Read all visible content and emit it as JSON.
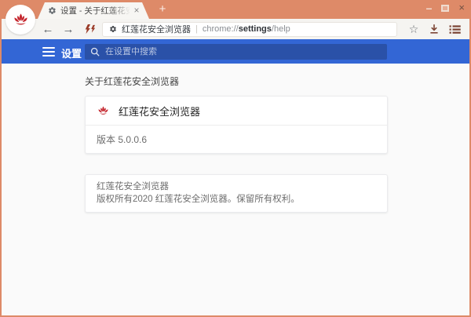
{
  "window_controls": {
    "minimize_glyph": "–",
    "close_glyph": "×"
  },
  "tabstrip": {
    "tab_title": "设置 - 关于红莲花安全浏览器",
    "tab_close_glyph": "×",
    "new_tab_glyph": "+"
  },
  "toolbar": {
    "back_glyph": "←",
    "forward_glyph": "→",
    "star_glyph": "☆",
    "site_label": "红莲花安全浏览器",
    "separator": "|",
    "url": {
      "scheme": "chrome://",
      "host": "settings",
      "path": "/help"
    }
  },
  "header": {
    "title": "设置",
    "search_placeholder": "在设置中搜索"
  },
  "content": {
    "section_title": "关于红莲花安全浏览器",
    "about_card": {
      "product_name": "红莲花安全浏览器",
      "version": "版本 5.0.0.6"
    },
    "copyright_card": {
      "line1": "红莲花安全浏览器",
      "line2": "版权所有2020 红莲花安全浏览器。保留所有权利。"
    }
  },
  "icons": {
    "app_logo": "red-lotus-flower",
    "tab_favicon": "gear",
    "omnibox_favicon": "gear",
    "speed_button": "dual-lightning-bolts",
    "download": "arrow-down-to-tray",
    "browser_menu": "bulleted-list",
    "settings_menu": "hamburger",
    "search": "magnifier"
  },
  "colors": {
    "frame_salmon": "#de8a68",
    "header_blue": "#3366d5",
    "search_field_blue": "#2a51a8",
    "lotus_red": "#c4252d",
    "toolbar_accent_red": "#8a4432",
    "content_bg": "#fafafa"
  }
}
